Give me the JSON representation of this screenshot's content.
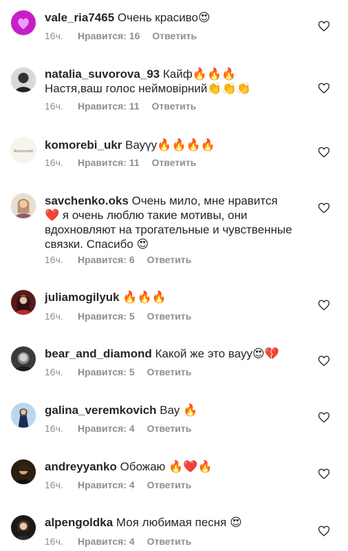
{
  "comments": [
    {
      "username": "vale_ria7465",
      "text": "Очень красиво😍",
      "time": "16ч.",
      "likes": "Нравится: 16",
      "reply": "Ответить"
    },
    {
      "username": "natalia_suvorova_93",
      "text": "Кайф🔥🔥🔥 Настя,ваш голос неймовірний👏👏👏",
      "time": "16ч.",
      "likes": "Нравится: 11",
      "reply": "Ответить"
    },
    {
      "username": "komorebi_ukr",
      "text": "Вауүу🔥🔥🔥🔥",
      "time": "16ч.",
      "likes": "Нравится: 11",
      "reply": "Ответить",
      "avatar_text": "Komorebi"
    },
    {
      "username": "savchenko.oks",
      "text": "Очень мило, мне нравится ❤️ я очень люблю такие мотивы, они вдохновляют на трогательные и чувственные связки. Спасибо 😍",
      "time": "16ч.",
      "likes": "Нравится: 6",
      "reply": "Ответить"
    },
    {
      "username": "juliamogilyuk",
      "text": "🔥🔥🔥",
      "time": "16ч.",
      "likes": "Нравится: 5",
      "reply": "Ответить"
    },
    {
      "username": "bear_and_diamond",
      "text": "Какой же это вауу😍💔",
      "time": "16ч.",
      "likes": "Нравится: 5",
      "reply": "Ответить"
    },
    {
      "username": "galina_veremkovich",
      "text": "Вау 🔥",
      "time": "16ч.",
      "likes": "Нравится: 4",
      "reply": "Ответить"
    },
    {
      "username": "andreyyanko",
      "text": "Обожаю 🔥❤️🔥",
      "time": "16ч.",
      "likes": "Нравится: 4",
      "reply": "Ответить"
    },
    {
      "username": "alpengoldka",
      "text": "Моя любимая песня 😍",
      "time": "16ч.",
      "likes": "Нравится: 4",
      "reply": "Ответить"
    }
  ],
  "colors": {
    "text": "#262626",
    "meta": "#8e8e8e",
    "heart": "#262626"
  },
  "icons": {
    "like": "heart-outline-icon"
  }
}
